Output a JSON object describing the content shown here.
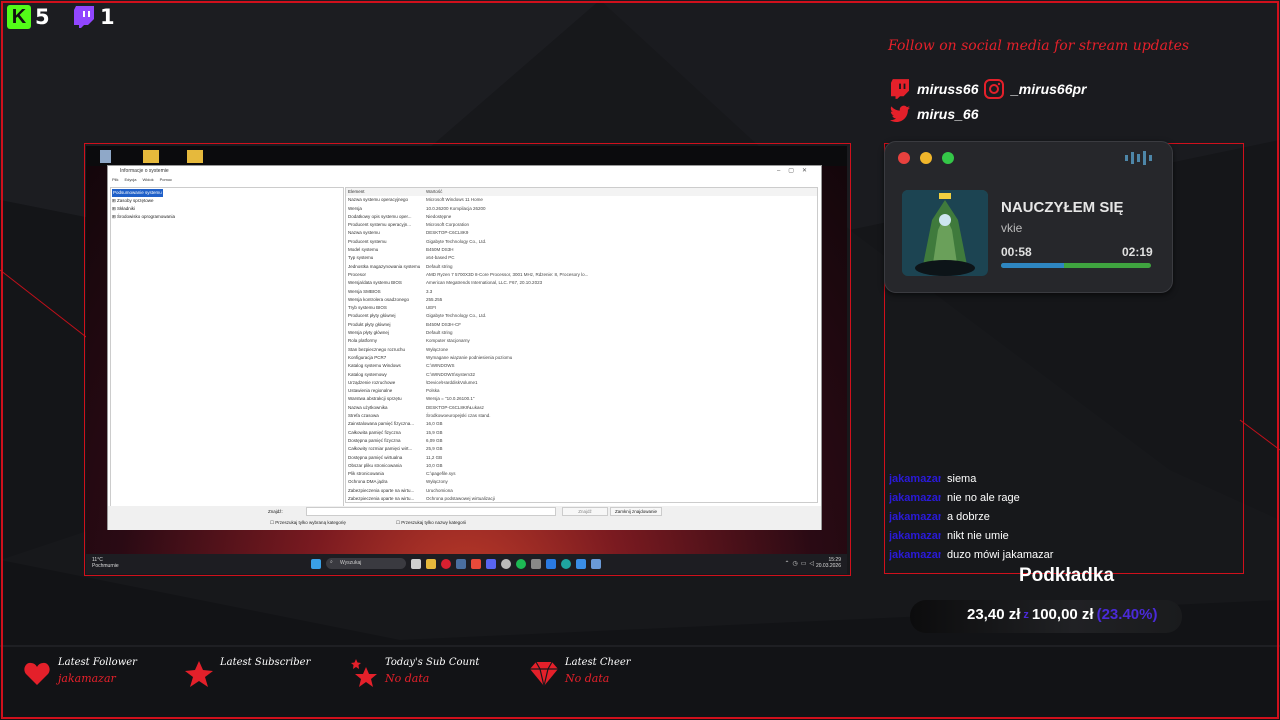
{
  "counters": {
    "kick": {
      "icon": "kick-icon",
      "value": "5",
      "color": "#53fc18"
    },
    "twitch": {
      "icon": "twitch-icon",
      "value": "1",
      "color": "#9146ff"
    }
  },
  "social": {
    "title": "Follow on social media for stream updates",
    "twitch": "miruss66",
    "instagram": "_mirus66pr",
    "twitter": "mirus_66"
  },
  "player": {
    "title": "NAUCZYŁEM SIĘ",
    "artist": "vkie",
    "current_time": "00:58",
    "total_time": "02:19",
    "progress_fraction": 0.42
  },
  "chat": [
    {
      "user": "jakamazar",
      "message": "siema"
    },
    {
      "user": "jakamazar",
      "message": "nie no ale rage"
    },
    {
      "user": "jakamazar",
      "message": "a dobrze"
    },
    {
      "user": "jakamazar",
      "message": "nikt nie umie"
    },
    {
      "user": "jakamazar",
      "message": "duzo mówi jakamazar"
    }
  ],
  "goal": {
    "title": "Podkładka",
    "current": "23,40 zł",
    "separator": "z",
    "target": "100,00 zł",
    "percent": "(23.40%)"
  },
  "alerts": [
    {
      "icon": "heart-icon",
      "label": "Latest Follower",
      "value": "jakamazar"
    },
    {
      "icon": "star-icon",
      "label": "Latest Subscriber",
      "value": ""
    },
    {
      "icon": "stars-icon",
      "label": "Today's Sub Count",
      "value": "No data"
    },
    {
      "icon": "diamond-icon",
      "label": "Latest Cheer",
      "value": "No data"
    }
  ],
  "colors": {
    "accent_red": "#e4202a",
    "chat_user": "#2a1ad8",
    "goal_purple": "#4a2ad8"
  },
  "capture": {
    "window_title": "Informacje o systemie",
    "menu": [
      "Plik",
      "Edycja",
      "Widok",
      "Pomoc"
    ],
    "tree": [
      "Podsumowanie systemu",
      "⊞ Zasoby sprzętowe",
      "⊞ Składniki",
      "⊞ Środowisko oprogramowania"
    ],
    "table_header": {
      "element": "Element",
      "value": "Wartość"
    },
    "rows": [
      [
        "Nazwa systemu operacyjnego",
        "Microsoft Windows 11 Home"
      ],
      [
        "Wersja",
        "10.0.26200 Kompilacja 26200"
      ],
      [
        "Dodatkowy opis systemu oper...",
        "Niedostępne"
      ],
      [
        "Producent systemu operacyjn...",
        "Microsoft Corporation"
      ],
      [
        "Nazwa systemu",
        "DESKTOP-C6CL8K9"
      ],
      [
        "Producent systemu",
        "Gigabyte Technology Co., Ltd."
      ],
      [
        "Model systemu",
        "B450M DS3H"
      ],
      [
        "Typ systemu",
        "x64-based PC"
      ],
      [
        "Jednostka magazynowania systemu",
        "Default string"
      ],
      [
        "Procesor",
        "AMD Ryzen 7 5700X3D 8-Core Processor, 3001 MHz, Rdzenie: 8, Procesory lo..."
      ],
      [
        "Wersja/data systemu BIOS",
        "American Megatrends International, LLC. F67, 20.10.2023"
      ],
      [
        "Wersja SMBIOS",
        "3.3"
      ],
      [
        "Wersja kontrolera osadzonego",
        "255.255"
      ],
      [
        "Tryb systemu BIOS",
        "UEFI"
      ],
      [
        "Producent płyty głównej",
        "Gigabyte Technology Co., Ltd."
      ],
      [
        "Produkt płyty głównej",
        "B450M DS3H-CF"
      ],
      [
        "Wersja płyty głównej",
        "Default string"
      ],
      [
        "Rola platformy",
        "Komputer stacjonarny"
      ],
      [
        "Stan bezpiecznego rozruchu",
        "Wyłączone"
      ],
      [
        "Konfiguracja PCR7",
        "Wymagane wiązanie podniesienia poziomu"
      ],
      [
        "Katalog systemu Windows",
        "C:\\WINDOWS"
      ],
      [
        "Katalog systemowy",
        "C:\\WINDOWS\\system32"
      ],
      [
        "Urządzenie rozruchowe",
        "\\Device\\HarddiskVolume1"
      ],
      [
        "Ustawienia regionalne",
        "Polska"
      ],
      [
        "Warstwa abstrakcji sprzętu",
        "Wersja = \"10.0.26100.1\""
      ],
      [
        "Nazwa użytkownika",
        "DESKTOP-C6CL8K9\\Łukasz"
      ],
      [
        "Strefa czasowa",
        "Środkowoeuropejski czas stand."
      ],
      [
        "Zainstalowana pamięć fizyczna...",
        "16,0 GB"
      ],
      [
        "Całkowita pamięć fizyczna",
        "15,9 GB"
      ],
      [
        "Dostępna pamięć fizyczna",
        "6,09 GB"
      ],
      [
        "Całkowity rozmiar pamięci wirt...",
        "25,9 GB"
      ],
      [
        "Dostępna pamięć wirtualna",
        "11,2 GB"
      ],
      [
        "Obszar pliku stronicowania",
        "10,0 GB"
      ],
      [
        "Plik stronicowania",
        "C:\\pagefile.sys"
      ],
      [
        "Ochrona DMA jądra",
        "Wyłączony"
      ],
      [
        "Zabezpieczenia oparte na wirtu...",
        "Uruchomiona"
      ],
      [
        "Zabezpieczenia oparte na wirtu...",
        "Ochrona podstawowej wirtualizacji"
      ]
    ],
    "find_label": "Znajdź:",
    "find_button": "Znajdź",
    "close_find_button": "Zamknij znajdowanie",
    "check_selected": "Przeszukaj tylko wybraną kategorię",
    "check_names": "Przeszukaj tylko nazwy kategorii",
    "weather_temp": "11°C",
    "weather_desc": "Pochmurnie",
    "search_placeholder": "Wyszukaj",
    "clock_time": "15:29",
    "clock_date": "20.03.2026"
  }
}
